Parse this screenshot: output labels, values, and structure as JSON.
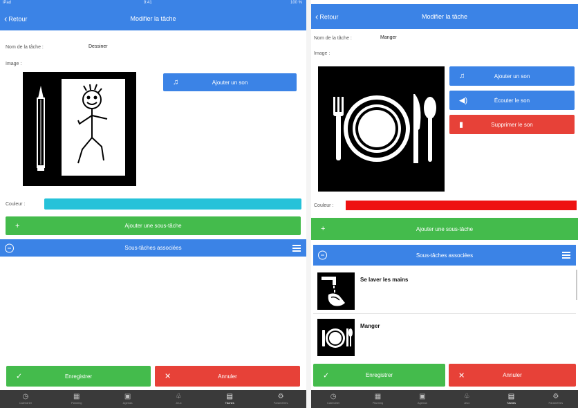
{
  "left": {
    "status": {
      "carrier": "iPad",
      "time": "9:41",
      "battery": "100 %"
    },
    "nav": {
      "back": "Retour",
      "title": "Modifier la tâche"
    },
    "task_name_label": "Nom de la tâche :",
    "task_name_value": "Dessiner",
    "image_label": "Image :",
    "add_sound_button": "Ajouter un son",
    "color_label": "Couleur :",
    "color_value": "#26c2d9",
    "add_subtask_button": "Ajouter une sous-tâche",
    "subtasks_header": "Sous-tâches associées",
    "save_button": "Enregistrer",
    "cancel_button": "Annuler"
  },
  "right": {
    "nav": {
      "back": "Retour",
      "title": "Modifier la tâche"
    },
    "task_name_label": "Nom de la tâche :",
    "task_name_value": "Manger",
    "image_label": "Image :",
    "add_sound_button": "Ajouter un son",
    "listen_sound_button": "Écouter le son",
    "delete_sound_button": "Supprimer le son",
    "color_label": "Couleur :",
    "color_value": "#ee1111",
    "add_subtask_button": "Ajouter une sous-tâche",
    "subtasks_header": "Sous-tâches associées",
    "subtasks": [
      {
        "name": "Se laver les mains",
        "icon": "washing-hands-icon"
      },
      {
        "name": "Manger",
        "icon": "plate-cutlery-icon"
      }
    ],
    "save_button": "Enregistrer",
    "cancel_button": "Annuler"
  },
  "tabbar": [
    {
      "label": "Calendrier",
      "icon": "calendar-icon"
    },
    {
      "label": "Planning",
      "icon": "planning-icon"
    },
    {
      "label": "Agenda",
      "icon": "agenda-icon"
    },
    {
      "label": "Jeux",
      "icon": "games-icon"
    },
    {
      "label": "Tâches",
      "icon": "tasks-icon",
      "active": true
    },
    {
      "label": "Paramètres",
      "icon": "settings-icon"
    }
  ]
}
